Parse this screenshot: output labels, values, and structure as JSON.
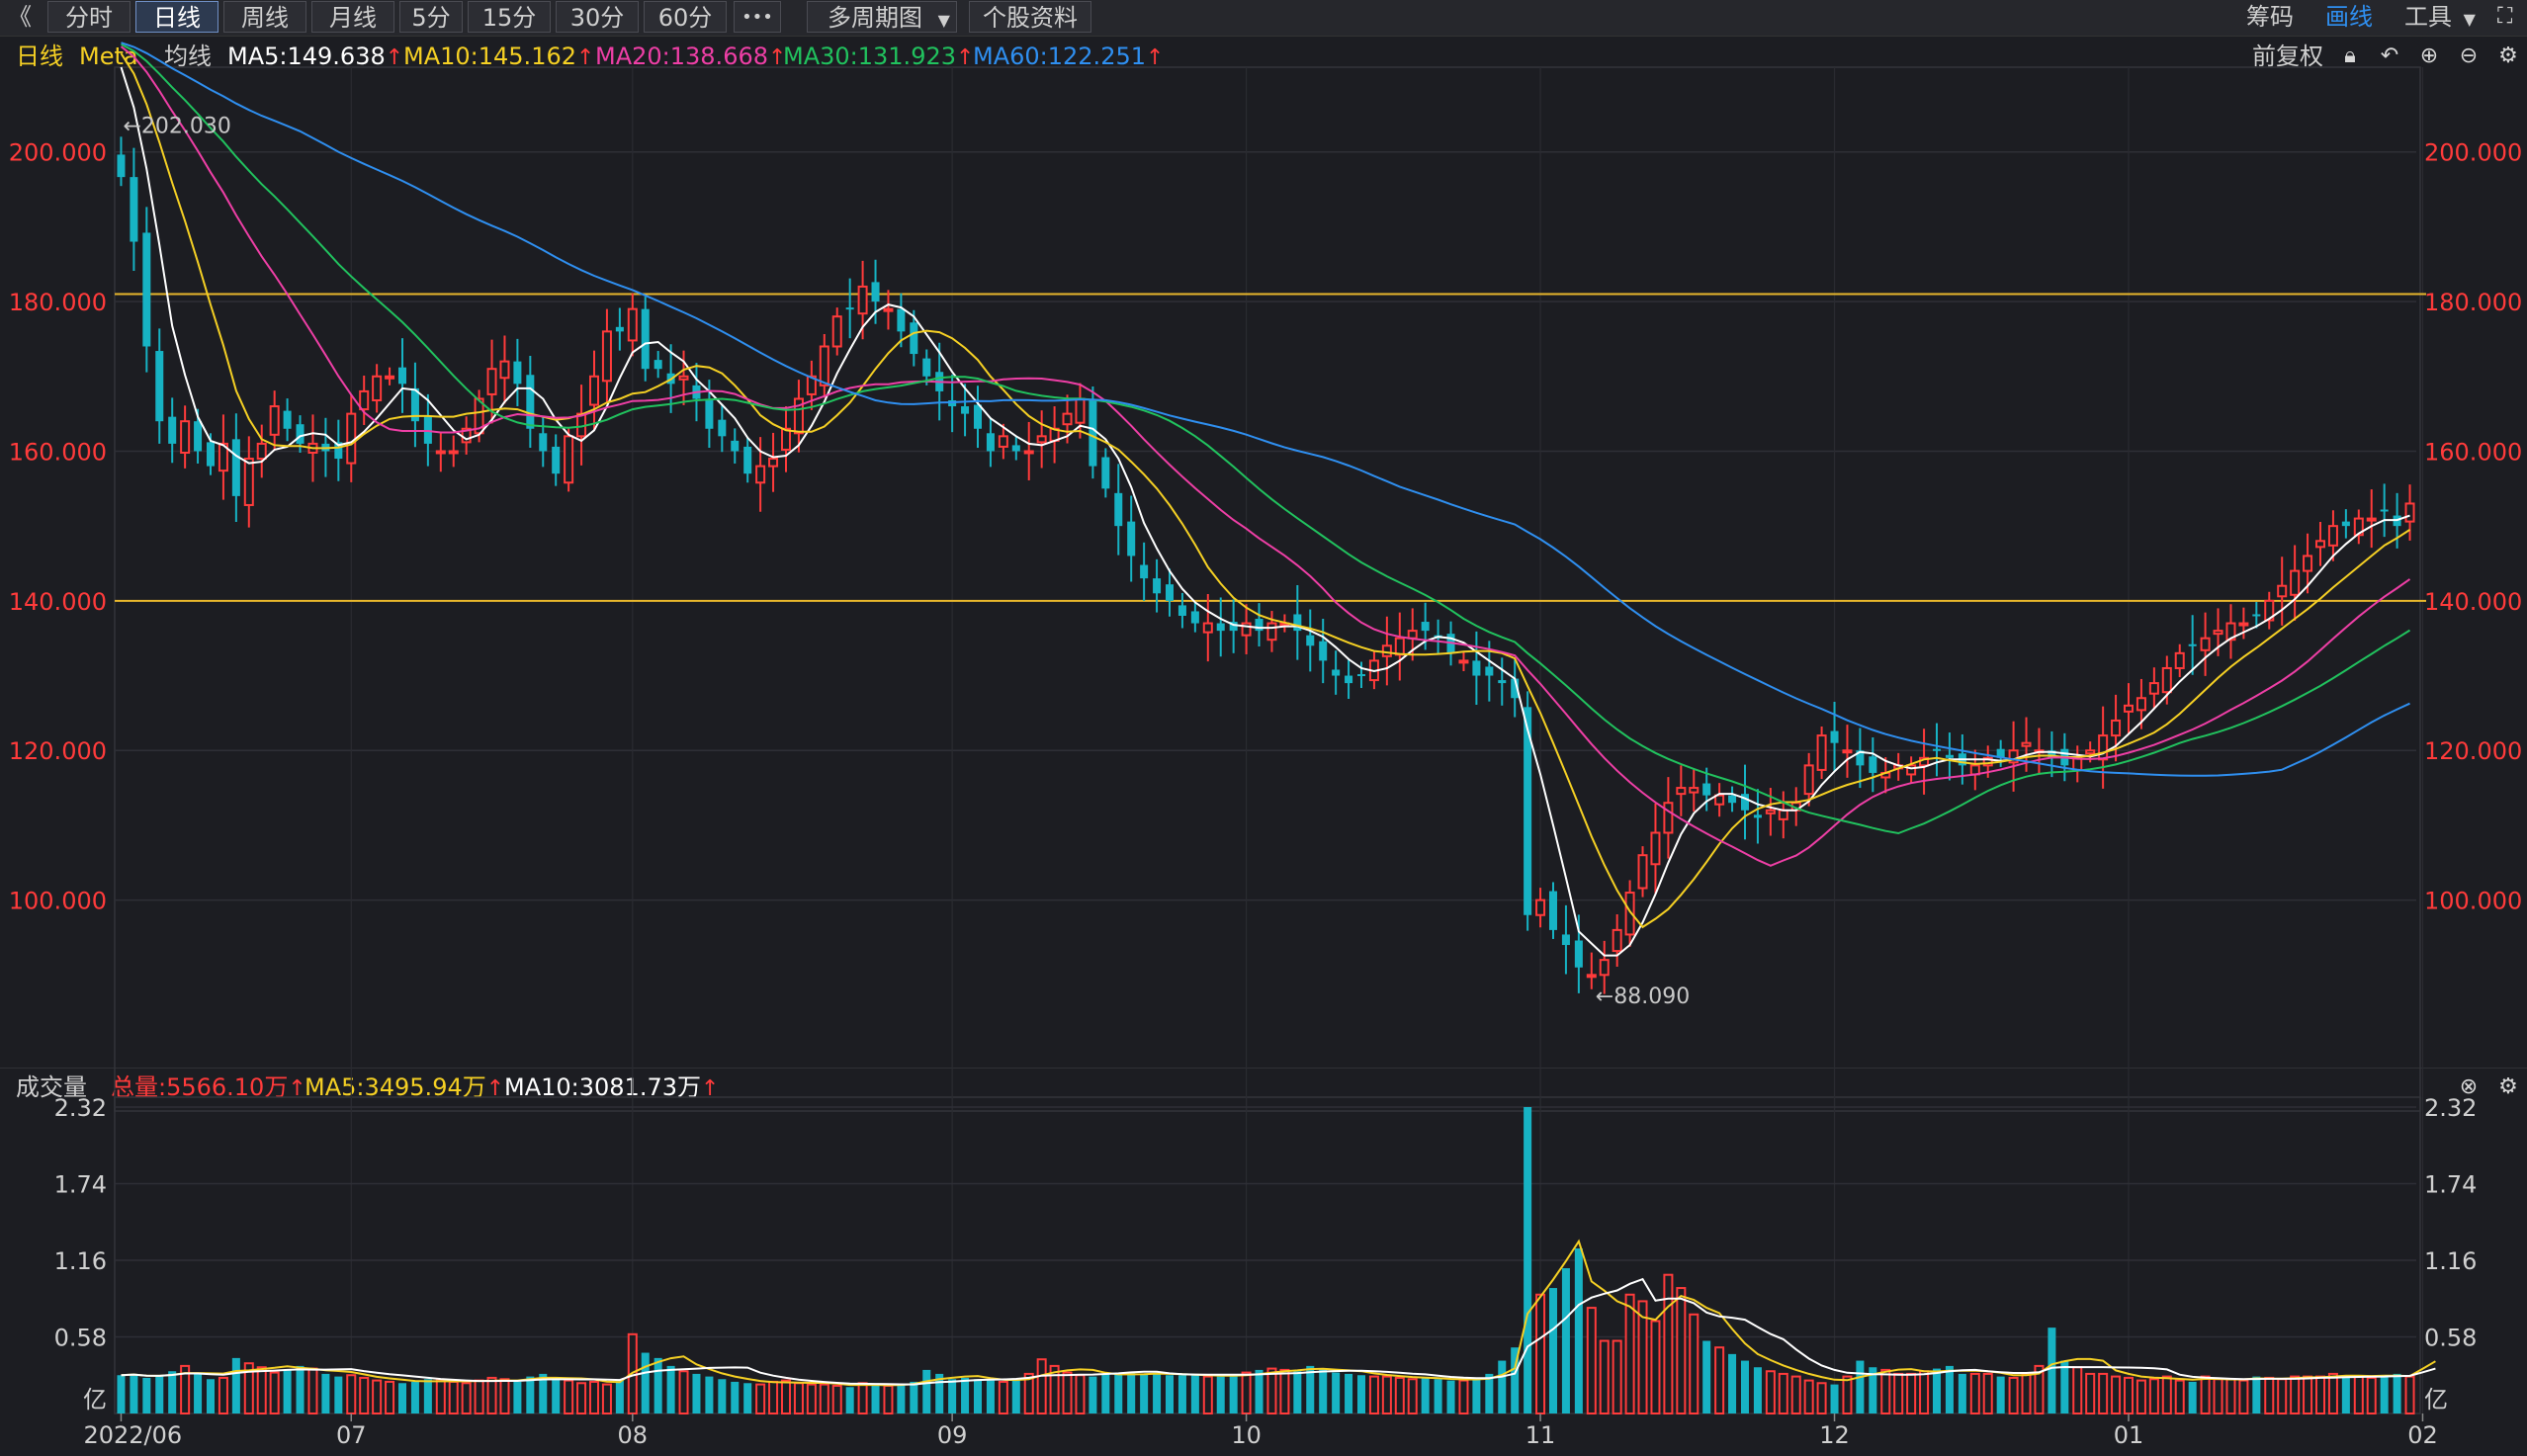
{
  "toolbar": {
    "back": "《",
    "tabs": [
      "分时",
      "日线",
      "周线",
      "月线",
      "5分",
      "15分",
      "30分",
      "60分",
      "•••"
    ],
    "active_tab": 1,
    "multi_period": "多周期图",
    "stock_info": "个股资料",
    "right": [
      "筹码",
      "画线",
      "工具"
    ]
  },
  "info": {
    "period": "日线",
    "name": "Meta",
    "ma_label": "均线",
    "ma5": "MA5:149.638",
    "ma10": "MA10:145.162",
    "ma20": "MA20:138.668",
    "ma30": "MA30:131.923",
    "ma60": "MA60:122.251",
    "adjust": "前复权"
  },
  "volume_header": {
    "title": "成交量",
    "total": "总量:5566.10万",
    "ma5": "MA5:3495.94万",
    "ma10": "MA10:3081.73万"
  },
  "colors": {
    "up": "#ff3b3b",
    "down": "#17b3c4",
    "ma5": "#ffffff",
    "ma10": "#f5d024",
    "ma20": "#ee3fa6",
    "ma30": "#21c25e",
    "ma60": "#2f8ff0",
    "hline": "#e8b72c"
  },
  "chart_data": {
    "type": "candlestick",
    "price_ticks": [
      "200.000",
      "180.000",
      "160.000",
      "140.000",
      "120.000",
      "100.000"
    ],
    "price_range": [
      80,
      210
    ],
    "volume_ticks": [
      "2.32",
      "1.74",
      "1.16",
      "0.58"
    ],
    "volume_unit": "亿",
    "volume_range": [
      0,
      2.32
    ],
    "x_labels": [
      "2022/06",
      "07",
      "08",
      "09",
      "10",
      "11",
      "12",
      "01",
      "02"
    ],
    "x_label_index": [
      0,
      18,
      40,
      65,
      88,
      111,
      134,
      157,
      180
    ],
    "high_annotation": "←202.030",
    "low_annotation": "←88.090",
    "high_index": 0,
    "low_index": 115,
    "horizontal_lines": [
      181,
      140
    ],
    "closes": [
      196.64,
      188,
      174,
      164,
      161,
      164,
      160,
      158,
      161,
      154,
      159,
      161,
      166,
      163,
      161,
      161,
      160,
      159,
      165,
      168,
      170,
      170,
      169,
      164,
      161,
      160,
      160,
      163,
      167,
      171,
      172,
      169,
      163,
      160,
      157,
      162,
      165,
      170,
      176,
      176,
      179,
      171,
      171,
      169,
      170,
      167,
      163,
      162,
      160,
      157,
      158,
      159,
      163,
      167,
      170,
      174,
      178,
      179,
      182,
      180,
      179,
      176,
      173,
      170,
      168,
      166,
      165,
      163,
      160,
      162,
      160,
      160,
      162,
      163,
      165,
      167,
      158,
      155,
      150,
      146,
      143,
      141,
      140,
      138,
      137,
      137,
      136,
      136,
      137,
      136,
      137,
      137,
      136,
      134,
      132,
      130,
      129,
      130,
      132,
      134,
      135,
      136,
      136,
      135,
      133,
      132,
      130,
      130,
      129,
      127,
      98,
      100,
      96,
      94,
      91,
      90,
      92,
      96,
      101,
      106,
      109,
      113,
      115,
      115,
      114,
      114,
      113,
      112,
      111,
      112,
      112,
      113,
      118,
      122,
      121,
      120,
      118,
      117,
      117,
      118,
      118,
      119,
      120,
      119,
      118,
      118,
      119,
      119,
      120,
      121,
      120,
      119,
      118,
      119,
      120,
      122,
      124,
      126,
      127,
      129,
      131,
      133,
      134,
      135,
      136,
      137,
      137,
      138,
      140,
      142,
      144,
      146,
      148,
      150,
      150,
      151,
      151,
      152,
      150,
      153
    ],
    "volumes": [
      0.29,
      0.3,
      0.27,
      0.28,
      0.32,
      0.36,
      0.3,
      0.26,
      0.27,
      0.42,
      0.38,
      0.35,
      0.31,
      0.33,
      0.36,
      0.34,
      0.3,
      0.28,
      0.29,
      0.27,
      0.25,
      0.24,
      0.23,
      0.24,
      0.26,
      0.25,
      0.24,
      0.23,
      0.25,
      0.27,
      0.26,
      0.24,
      0.28,
      0.3,
      0.27,
      0.25,
      0.23,
      0.24,
      0.22,
      0.25,
      0.6,
      0.46,
      0.42,
      0.36,
      0.32,
      0.3,
      0.28,
      0.26,
      0.24,
      0.23,
      0.22,
      0.24,
      0.25,
      0.23,
      0.22,
      0.22,
      0.21,
      0.2,
      0.23,
      0.22,
      0.21,
      0.22,
      0.24,
      0.33,
      0.3,
      0.26,
      0.27,
      0.26,
      0.25,
      0.24,
      0.25,
      0.3,
      0.41,
      0.36,
      0.31,
      0.29,
      0.28,
      0.3,
      0.3,
      0.31,
      0.3,
      0.3,
      0.29,
      0.29,
      0.29,
      0.28,
      0.28,
      0.29,
      0.31,
      0.33,
      0.34,
      0.33,
      0.32,
      0.36,
      0.34,
      0.31,
      0.3,
      0.29,
      0.28,
      0.28,
      0.27,
      0.26,
      0.27,
      0.26,
      0.25,
      0.25,
      0.26,
      0.3,
      0.4,
      0.5,
      2.32,
      0.9,
      0.95,
      1.1,
      1.25,
      0.8,
      0.55,
      0.55,
      0.9,
      0.85,
      0.7,
      1.05,
      0.95,
      0.75,
      0.55,
      0.5,
      0.45,
      0.4,
      0.35,
      0.32,
      0.3,
      0.28,
      0.25,
      0.23,
      0.22,
      0.28,
      0.4,
      0.35,
      0.33,
      0.3,
      0.3,
      0.32,
      0.34,
      0.36,
      0.3,
      0.3,
      0.3,
      0.28,
      0.27,
      0.3,
      0.36,
      0.65,
      0.4,
      0.35,
      0.3,
      0.3,
      0.28,
      0.27,
      0.25,
      0.26,
      0.28,
      0.25,
      0.24,
      0.28,
      0.26,
      0.26,
      0.25,
      0.28,
      0.27,
      0.26,
      0.28,
      0.28,
      0.28,
      0.3,
      0.29,
      0.28,
      0.27,
      0.29,
      0.3,
      0.28,
      0.55,
      0.556
    ]
  }
}
